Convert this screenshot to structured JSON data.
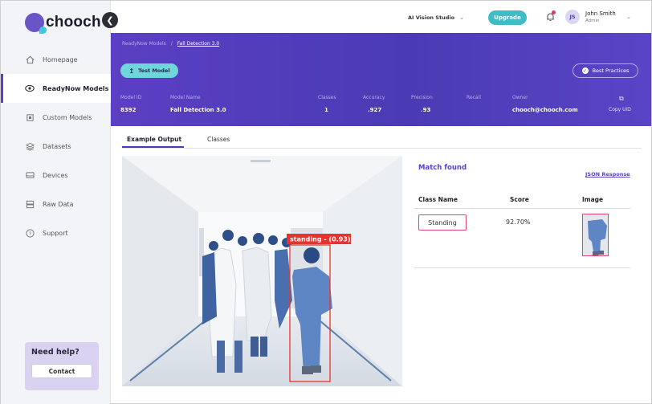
{
  "brand": {
    "name": "chooch"
  },
  "sidebar": {
    "items": [
      {
        "label": "Homepage"
      },
      {
        "label": "ReadyNow Models"
      },
      {
        "label": "Custom Models"
      },
      {
        "label": "Datasets"
      },
      {
        "label": "Devices"
      },
      {
        "label": "Raw Data"
      },
      {
        "label": "Support"
      }
    ],
    "active_index": 1,
    "help": {
      "title": "Need help?",
      "button": "Contact"
    }
  },
  "topbar": {
    "studio": "AI Vision Studio",
    "upgrade": "Upgrade",
    "user": {
      "initials": "JS",
      "name": "John Smith",
      "role": "Admin"
    }
  },
  "header": {
    "breadcrumb": [
      "ReadyNow Models",
      "Fall Detection 3.0"
    ],
    "test_button": "Test Model",
    "best_practices": "Best Practices",
    "meta": [
      {
        "label": "Model ID",
        "value": "8392"
      },
      {
        "label": "Model Name",
        "value": "Fall Detection 3.0"
      },
      {
        "label": "Classes",
        "value": "1"
      },
      {
        "label": "Accuracy",
        "value": ".927"
      },
      {
        "label": "Precision",
        "value": ".93"
      },
      {
        "label": "Recall",
        "value": ""
      },
      {
        "label": "Owner",
        "value": "chooch@chooch.com"
      }
    ],
    "copy_uid": "Copy UID"
  },
  "tabs": [
    {
      "label": "Example Output"
    },
    {
      "label": "Classes"
    }
  ],
  "detection": {
    "label": "standing - (0.93)",
    "color": "#e8322e"
  },
  "results": {
    "title": "Match found",
    "json_link": "JSON Response",
    "columns": [
      "Class Name",
      "Score",
      "Image"
    ],
    "rows": [
      {
        "class_name": "Standing",
        "score": "92.70%"
      }
    ]
  },
  "colors": {
    "accent": "#5a3fc0",
    "teal": "#3fbcc6",
    "highlight": "#e0456a"
  }
}
